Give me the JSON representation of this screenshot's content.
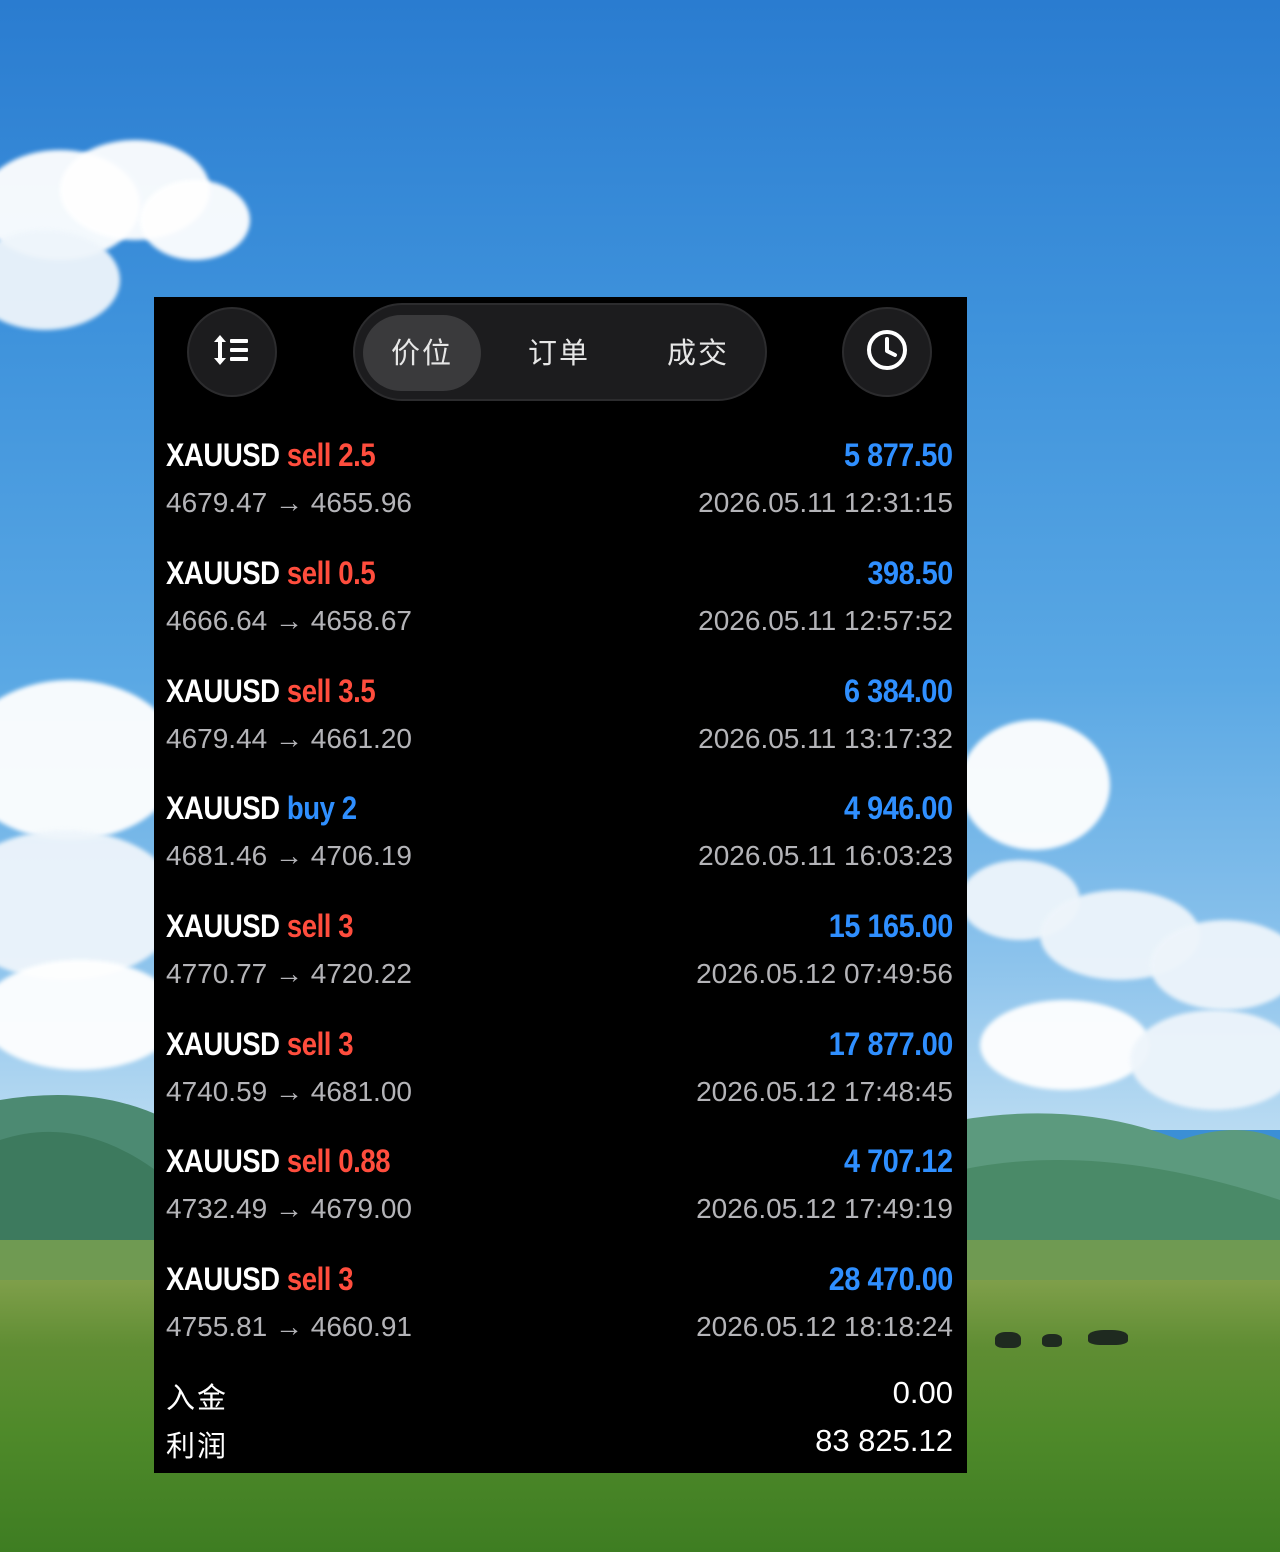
{
  "tabs": [
    {
      "label": "价位",
      "active": true
    },
    {
      "label": "订单",
      "active": false
    },
    {
      "label": "成交",
      "active": false
    }
  ],
  "icons": {
    "sort": "sort-icon",
    "history": "clock-icon"
  },
  "colors": {
    "sell": "#ff4d3d",
    "buy": "#2f8fff",
    "profit": "#2f8fff"
  },
  "deals": [
    {
      "symbol": "XAUUSD",
      "direction": "sell",
      "volume": "2.5",
      "prices": "4679.47 → 4655.96",
      "profit": "5 877.50",
      "time": "2026.05.11 12:31:15"
    },
    {
      "symbol": "XAUUSD",
      "direction": "sell",
      "volume": "0.5",
      "prices": "4666.64 → 4658.67",
      "profit": "398.50",
      "time": "2026.05.11 12:57:52"
    },
    {
      "symbol": "XAUUSD",
      "direction": "sell",
      "volume": "3.5",
      "prices": "4679.44 → 4661.20",
      "profit": "6 384.00",
      "time": "2026.05.11 13:17:32"
    },
    {
      "symbol": "XAUUSD",
      "direction": "buy",
      "volume": "2",
      "prices": "4681.46 → 4706.19",
      "profit": "4 946.00",
      "time": "2026.05.11 16:03:23"
    },
    {
      "symbol": "XAUUSD",
      "direction": "sell",
      "volume": "3",
      "prices": "4770.77 → 4720.22",
      "profit": "15 165.00",
      "time": "2026.05.12 07:49:56"
    },
    {
      "symbol": "XAUUSD",
      "direction": "sell",
      "volume": "3",
      "prices": "4740.59 → 4681.00",
      "profit": "17 877.00",
      "time": "2026.05.12 17:48:45"
    },
    {
      "symbol": "XAUUSD",
      "direction": "sell",
      "volume": "0.88",
      "prices": "4732.49 → 4679.00",
      "profit": "4 707.12",
      "time": "2026.05.12 17:49:19"
    },
    {
      "symbol": "XAUUSD",
      "direction": "sell",
      "volume": "3",
      "prices": "4755.81 → 4660.91",
      "profit": "28 470.00",
      "time": "2026.05.12 18:18:24"
    }
  ],
  "summary": {
    "deposit_label": "入金",
    "deposit_value": "0.00",
    "profit_label": "利润",
    "profit_value": "83 825.12"
  }
}
